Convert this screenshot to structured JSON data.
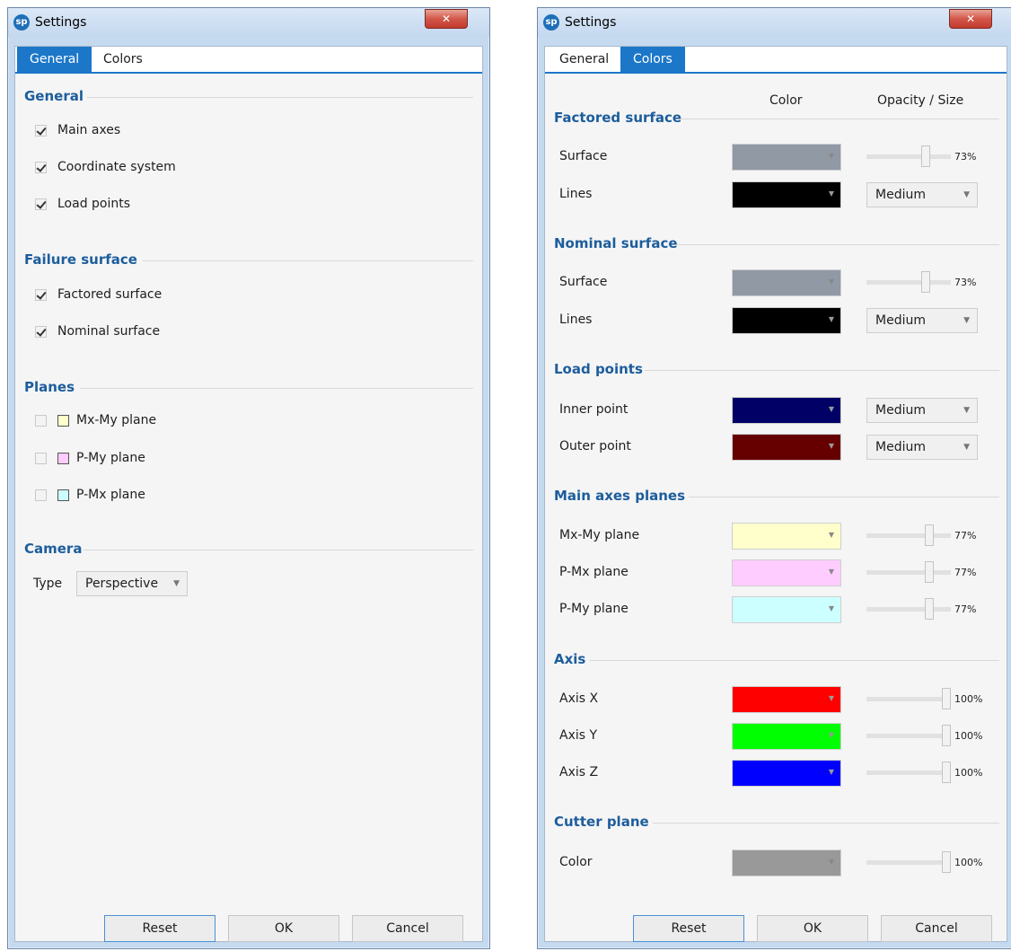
{
  "left": {
    "title": "Settings",
    "tabs": [
      "General",
      "Colors"
    ],
    "sections": {
      "general": "General",
      "failure": "Failure surface",
      "planes": "Planes",
      "camera": "Camera"
    },
    "general_items": [
      {
        "label": "Main axes",
        "checked": true
      },
      {
        "label": "Coordinate system",
        "checked": true
      },
      {
        "label": "Load points",
        "checked": true
      }
    ],
    "failure_items": [
      {
        "label": "Factored surface",
        "checked": true
      },
      {
        "label": "Nominal surface",
        "checked": true
      }
    ],
    "plane_items": [
      {
        "label": "Mx-My plane",
        "checked": false,
        "color": "#ffffcc"
      },
      {
        "label": "P-My plane",
        "checked": false,
        "color": "#ffccff"
      },
      {
        "label": "P-Mx plane",
        "checked": false,
        "color": "#ccffff"
      }
    ],
    "camera": {
      "type_label": "Type",
      "type_value": "Perspective"
    },
    "buttons": {
      "reset": "Reset",
      "ok": "OK",
      "cancel": "Cancel"
    }
  },
  "right": {
    "title": "Settings",
    "tabs": [
      "General",
      "Colors"
    ],
    "col_color": "Color",
    "col_opacity": "Opacity / Size",
    "sections": {
      "factored": "Factored surface",
      "nominal": "Nominal surface",
      "load": "Load points",
      "planes": "Main axes planes",
      "axis": "Axis",
      "cutter": "Cutter plane"
    },
    "factored": [
      {
        "label": "Surface",
        "color": "#9199a5",
        "opacity": "73%",
        "fraction": 0.73
      },
      {
        "label": "Lines",
        "color": "#000000",
        "size": "Medium"
      }
    ],
    "nominal": [
      {
        "label": "Surface",
        "color": "#9199a5",
        "opacity": "73%",
        "fraction": 0.73
      },
      {
        "label": "Lines",
        "color": "#000000",
        "size": "Medium"
      }
    ],
    "load": [
      {
        "label": "Inner point",
        "color": "#000066",
        "size": "Medium"
      },
      {
        "label": "Outer point",
        "color": "#660000",
        "size": "Medium"
      }
    ],
    "planes": [
      {
        "label": "Mx-My plane",
        "color": "#ffffcc",
        "opacity": "77%",
        "fraction": 0.77
      },
      {
        "label": "P-Mx plane",
        "color": "#ffccff",
        "opacity": "77%",
        "fraction": 0.77
      },
      {
        "label": "P-My plane",
        "color": "#ccffff",
        "opacity": "77%",
        "fraction": 0.77
      }
    ],
    "axis": [
      {
        "label": "Axis X",
        "color": "#ff0000",
        "opacity": "100%",
        "fraction": 1.0
      },
      {
        "label": "Axis Y",
        "color": "#00ff00",
        "opacity": "100%",
        "fraction": 1.0
      },
      {
        "label": "Axis Z",
        "color": "#0000ff",
        "opacity": "100%",
        "fraction": 1.0
      }
    ],
    "cutter": [
      {
        "label": "Color",
        "color": "#999999",
        "opacity": "100%",
        "fraction": 1.0
      }
    ],
    "buttons": {
      "reset": "Reset",
      "ok": "OK",
      "cancel": "Cancel"
    }
  }
}
